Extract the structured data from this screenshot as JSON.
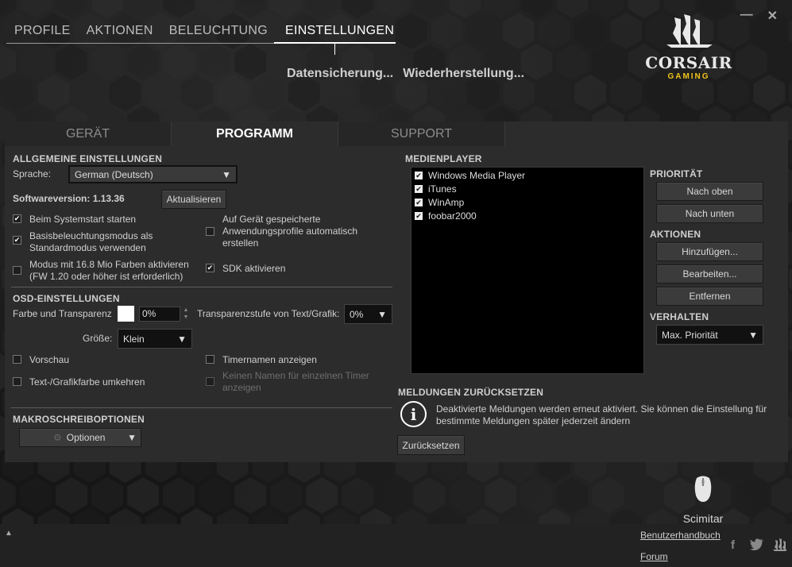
{
  "window": {
    "minimize_glyph": "—",
    "close_glyph": "✕"
  },
  "topnav": {
    "tabs": [
      {
        "label": "PROFILE"
      },
      {
        "label": "AKTIONEN"
      },
      {
        "label": "BELEUCHTUNG"
      },
      {
        "label": "EINSTELLUNGEN"
      }
    ],
    "active_index": 3
  },
  "backup": {
    "save_label": "Datensicherung...",
    "restore_label": "Wiederherstellung..."
  },
  "logo": {
    "brand": "CORSAIR",
    "sub": "GAMING"
  },
  "subtabs": [
    {
      "label": "GERÄT"
    },
    {
      "label": "PROGRAMM"
    },
    {
      "label": "SUPPORT"
    }
  ],
  "general": {
    "title": "ALLGEMEINE EINSTELLUNGEN",
    "language_label": "Sprache:",
    "language_value": "German (Deutsch)",
    "version_label": "Softwareversion: 1.13.36",
    "update_button": "Aktualisieren",
    "options": {
      "startup": {
        "label": "Beim Systemstart starten",
        "checked": true
      },
      "basic_lighting_1": {
        "label": "Basisbeleuchtungsmodus als",
        "checked": true
      },
      "basic_lighting_2": "Standardmodus verwenden",
      "mode16_1": {
        "label": "Modus mit 16.8 Mio Farben aktivieren",
        "checked": false
      },
      "mode16_2": "(FW 1.20 oder höher ist erforderlich)",
      "auto_profiles_1": {
        "label": "Auf Gerät gespeicherte",
        "checked": false
      },
      "auto_profiles_2": "Anwendungsprofile automatisch",
      "auto_profiles_3": "erstellen",
      "sdk": {
        "label": "SDK aktivieren",
        "checked": true
      }
    }
  },
  "osd": {
    "title": "OSD-EINSTELLUNGEN",
    "color_label": "Farbe und Transparenz",
    "color_value": "#ffffff",
    "transparency_value": "0%",
    "text_transparency_label": "Transparenzstufe von Text/Grafik:",
    "text_transparency_value": "0%",
    "size_label": "Größe:",
    "size_value": "Klein",
    "preview": {
      "label": "Vorschau",
      "checked": false
    },
    "timer_names": {
      "label": "Timernamen anzeigen",
      "checked": false
    },
    "invert_color": {
      "label": "Text-/Grafikfarbe umkehren",
      "checked": false
    },
    "no_name_1": {
      "label": "Keinen Namen für einzelnen Timer",
      "checked": false
    },
    "no_name_2": "anzeigen"
  },
  "macro": {
    "title": "MAKROSCHREIBOPTIONEN",
    "options_button": "Optionen"
  },
  "media": {
    "title": "MEDIENPLAYER",
    "players": [
      {
        "name": "Windows Media Player",
        "checked": true
      },
      {
        "name": "iTunes",
        "checked": true
      },
      {
        "name": "WinAmp",
        "checked": true
      },
      {
        "name": "foobar2000",
        "checked": true
      }
    ],
    "priority_title": "PRIORITÄT",
    "up_button": "Nach oben",
    "down_button": "Nach unten",
    "actions_title": "AKTIONEN",
    "add_button": "Hinzufügen...",
    "edit_button": "Bearbeiten...",
    "remove_button": "Entfernen",
    "behavior_title": "VERHALTEN",
    "behavior_value": "Max. Priorität"
  },
  "reset": {
    "title": "MELDUNGEN ZURÜCKSETZEN",
    "text_1": "Deaktivierte Meldungen werden erneut aktiviert. Sie können die Einstellung für",
    "text_2": "bestimmte Meldungen später jederzeit ändern",
    "button": "Zurücksetzen"
  },
  "device": {
    "name": "Scimitar"
  },
  "footer": {
    "manual_link": "Benutzerhandbuch",
    "forum_link": "Forum"
  },
  "colors": {
    "accent": "#f0c419",
    "panel": "#2c2c2c",
    "background": "#1a1a1a"
  }
}
